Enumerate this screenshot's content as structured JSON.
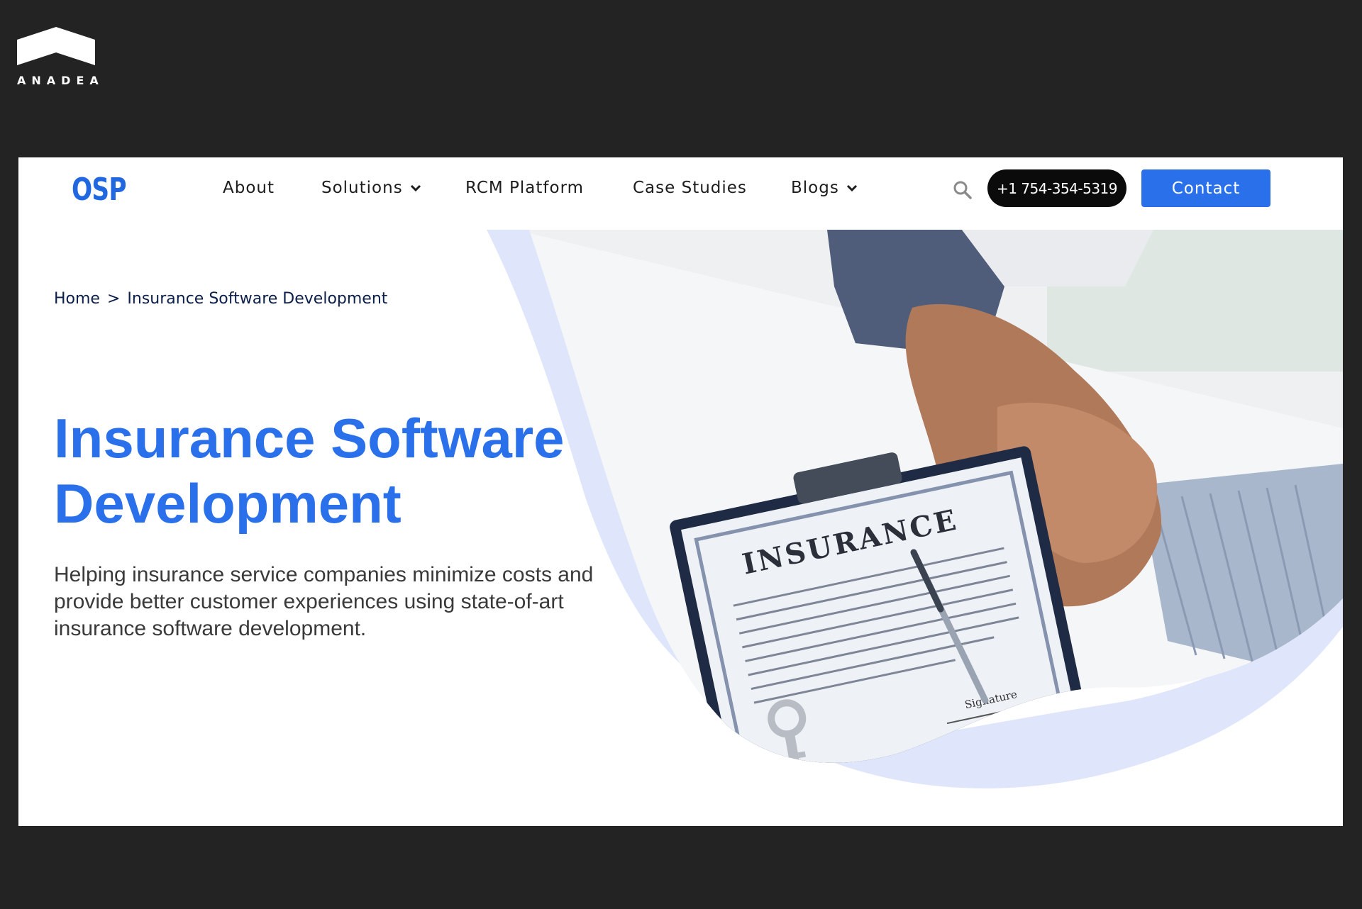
{
  "brand": {
    "name": "ANADEA"
  },
  "nav": {
    "logo": "OSP",
    "items": [
      {
        "label": "About",
        "has_dropdown": false
      },
      {
        "label": "Solutions",
        "has_dropdown": true
      },
      {
        "label": "RCM Platform",
        "has_dropdown": false
      },
      {
        "label": "Case Studies",
        "has_dropdown": false
      },
      {
        "label": "Blogs",
        "has_dropdown": true
      }
    ],
    "search_icon": "search-icon",
    "phone": "+1 754-354-5319",
    "contact_label": "Contact"
  },
  "breadcrumb": {
    "home": "Home",
    "separator": ">",
    "current": "Insurance Software Development"
  },
  "hero": {
    "title_line1": "Insurance Software",
    "title_line2": "Development",
    "description": "Helping insurance service companies minimize costs and provide better customer experiences using state-of-art insurance software development.",
    "image": {
      "clipboard_heading": "INSURANCE",
      "signature_label": "Signature"
    }
  },
  "colors": {
    "page_background": "#232323",
    "accent_blue": "#2a70ea",
    "phone_button": "#0b0b0b",
    "breadcrumb_text": "#0c1f4a",
    "shape_light_blue": "#dfe6fb"
  }
}
